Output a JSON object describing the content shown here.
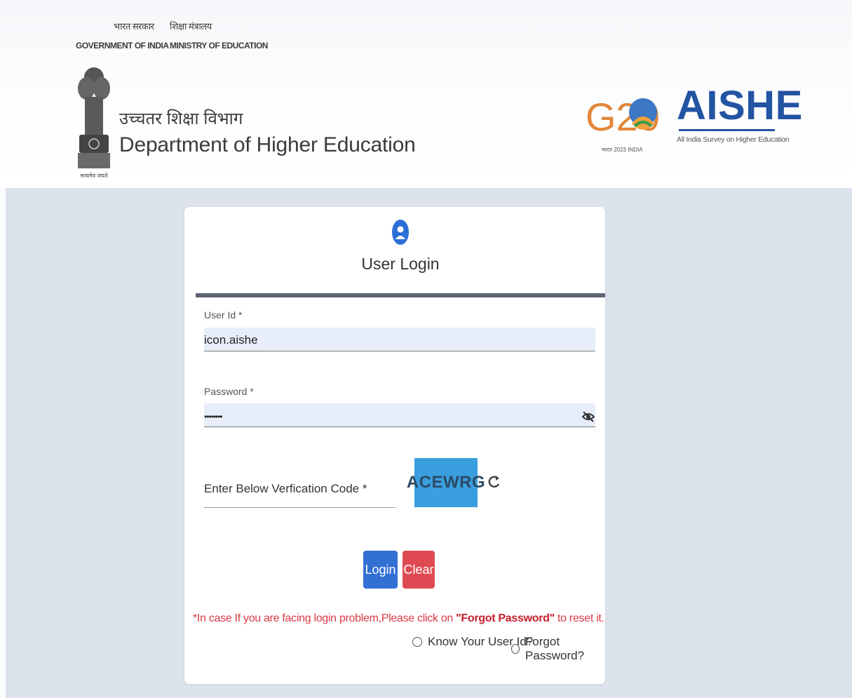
{
  "header": {
    "gov_hindi": "भारत सरकार",
    "gov_en": "GOVERNMENT OF INDIA",
    "ministry_hindi": "शिक्षा मंत्रालय",
    "ministry_en": "MINISTRY OF EDUCATION",
    "emblem_motto": "सत्यमेव जयते",
    "dept_hindi": "उच्चतर शिक्षा विभाग",
    "dept_en": "Department of Higher Education",
    "g20_text": "G20",
    "g20_sub": "भारत 2023 INDIA",
    "aishe_title": "AISHE",
    "aishe_sub": "All India Survey on Higher Education"
  },
  "login": {
    "title": "User Login",
    "user_id_label": "User Id *",
    "user_id_value": "icon.aishe",
    "password_label": "Password *",
    "password_value": "••••••••",
    "captcha_label": "Enter Below Verfication Code *",
    "captcha_code": "ACEWRG",
    "login_button": "Login",
    "clear_button": "Clear",
    "notice_prefix": "*In case If you are facing login problem,Please click on ",
    "notice_link": "\"Forgot Password\"",
    "notice_suffix": " to reset it.",
    "know_user_id": "Know Your User Id?",
    "forgot_password": "Forgot Password?"
  },
  "colors": {
    "primary": "#3270d4",
    "danger": "#df4a52",
    "captcha_bg": "#3a9fde",
    "aishe_blue": "#2354a3",
    "band_bg": "#dde3ec"
  },
  "icons": [
    "national-emblem-icon",
    "g20-logo-icon",
    "user-icon",
    "eye-slash-icon",
    "refresh-icon"
  ]
}
